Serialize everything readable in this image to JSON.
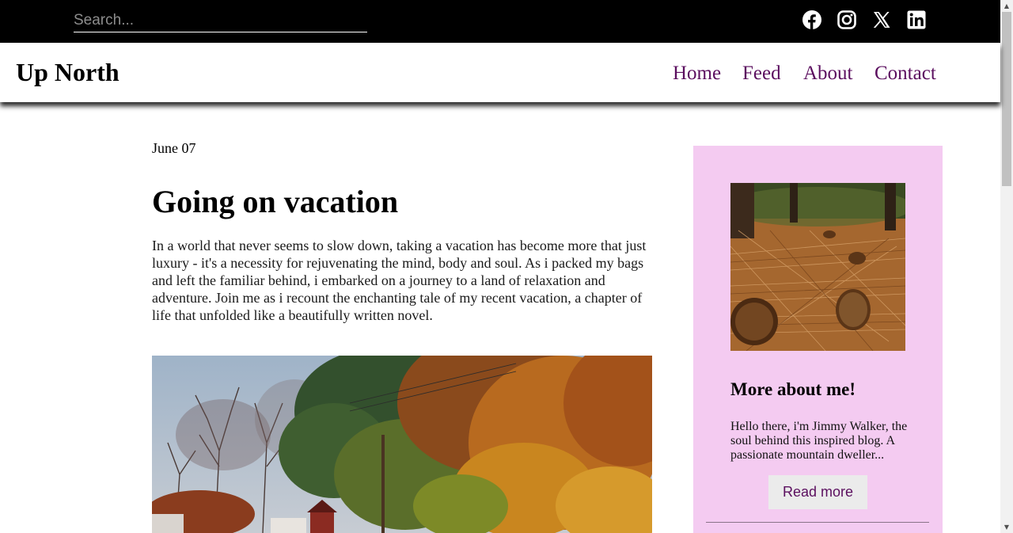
{
  "search": {
    "placeholder": "Search..."
  },
  "social": [
    {
      "name": "facebook-icon"
    },
    {
      "name": "instagram-icon"
    },
    {
      "name": "x-icon"
    },
    {
      "name": "linkedin-icon"
    }
  ],
  "header": {
    "brand": "Up North",
    "nav": [
      "Home",
      "Feed",
      "About",
      "Contact"
    ]
  },
  "post": {
    "date": "June 07",
    "title": "Going on vacation",
    "lead": "In a world that never seems to slow down, taking a vacation has become more that just luxury - it's a necessity for rejuvenating the mind, body and soul. As i packed my bags and left the familiar behind, i embarked on a journey to a land of relaxation and adventure. Join me as i recount the enchanting tale of my recent vacation, a chapter of life that unfolded like a beautifully written novel."
  },
  "sidebar": {
    "title": "More about me!",
    "text": "Hello there, i'm Jimmy Walker, the soul behind this inspired blog. A passionate mountain dweller...",
    "button": "Read more"
  },
  "colors": {
    "topbar": "#000000",
    "nav_link": "#5b0f5f",
    "sidebar_bg": "#f4cbf1",
    "button_bg": "#ebebeb"
  }
}
